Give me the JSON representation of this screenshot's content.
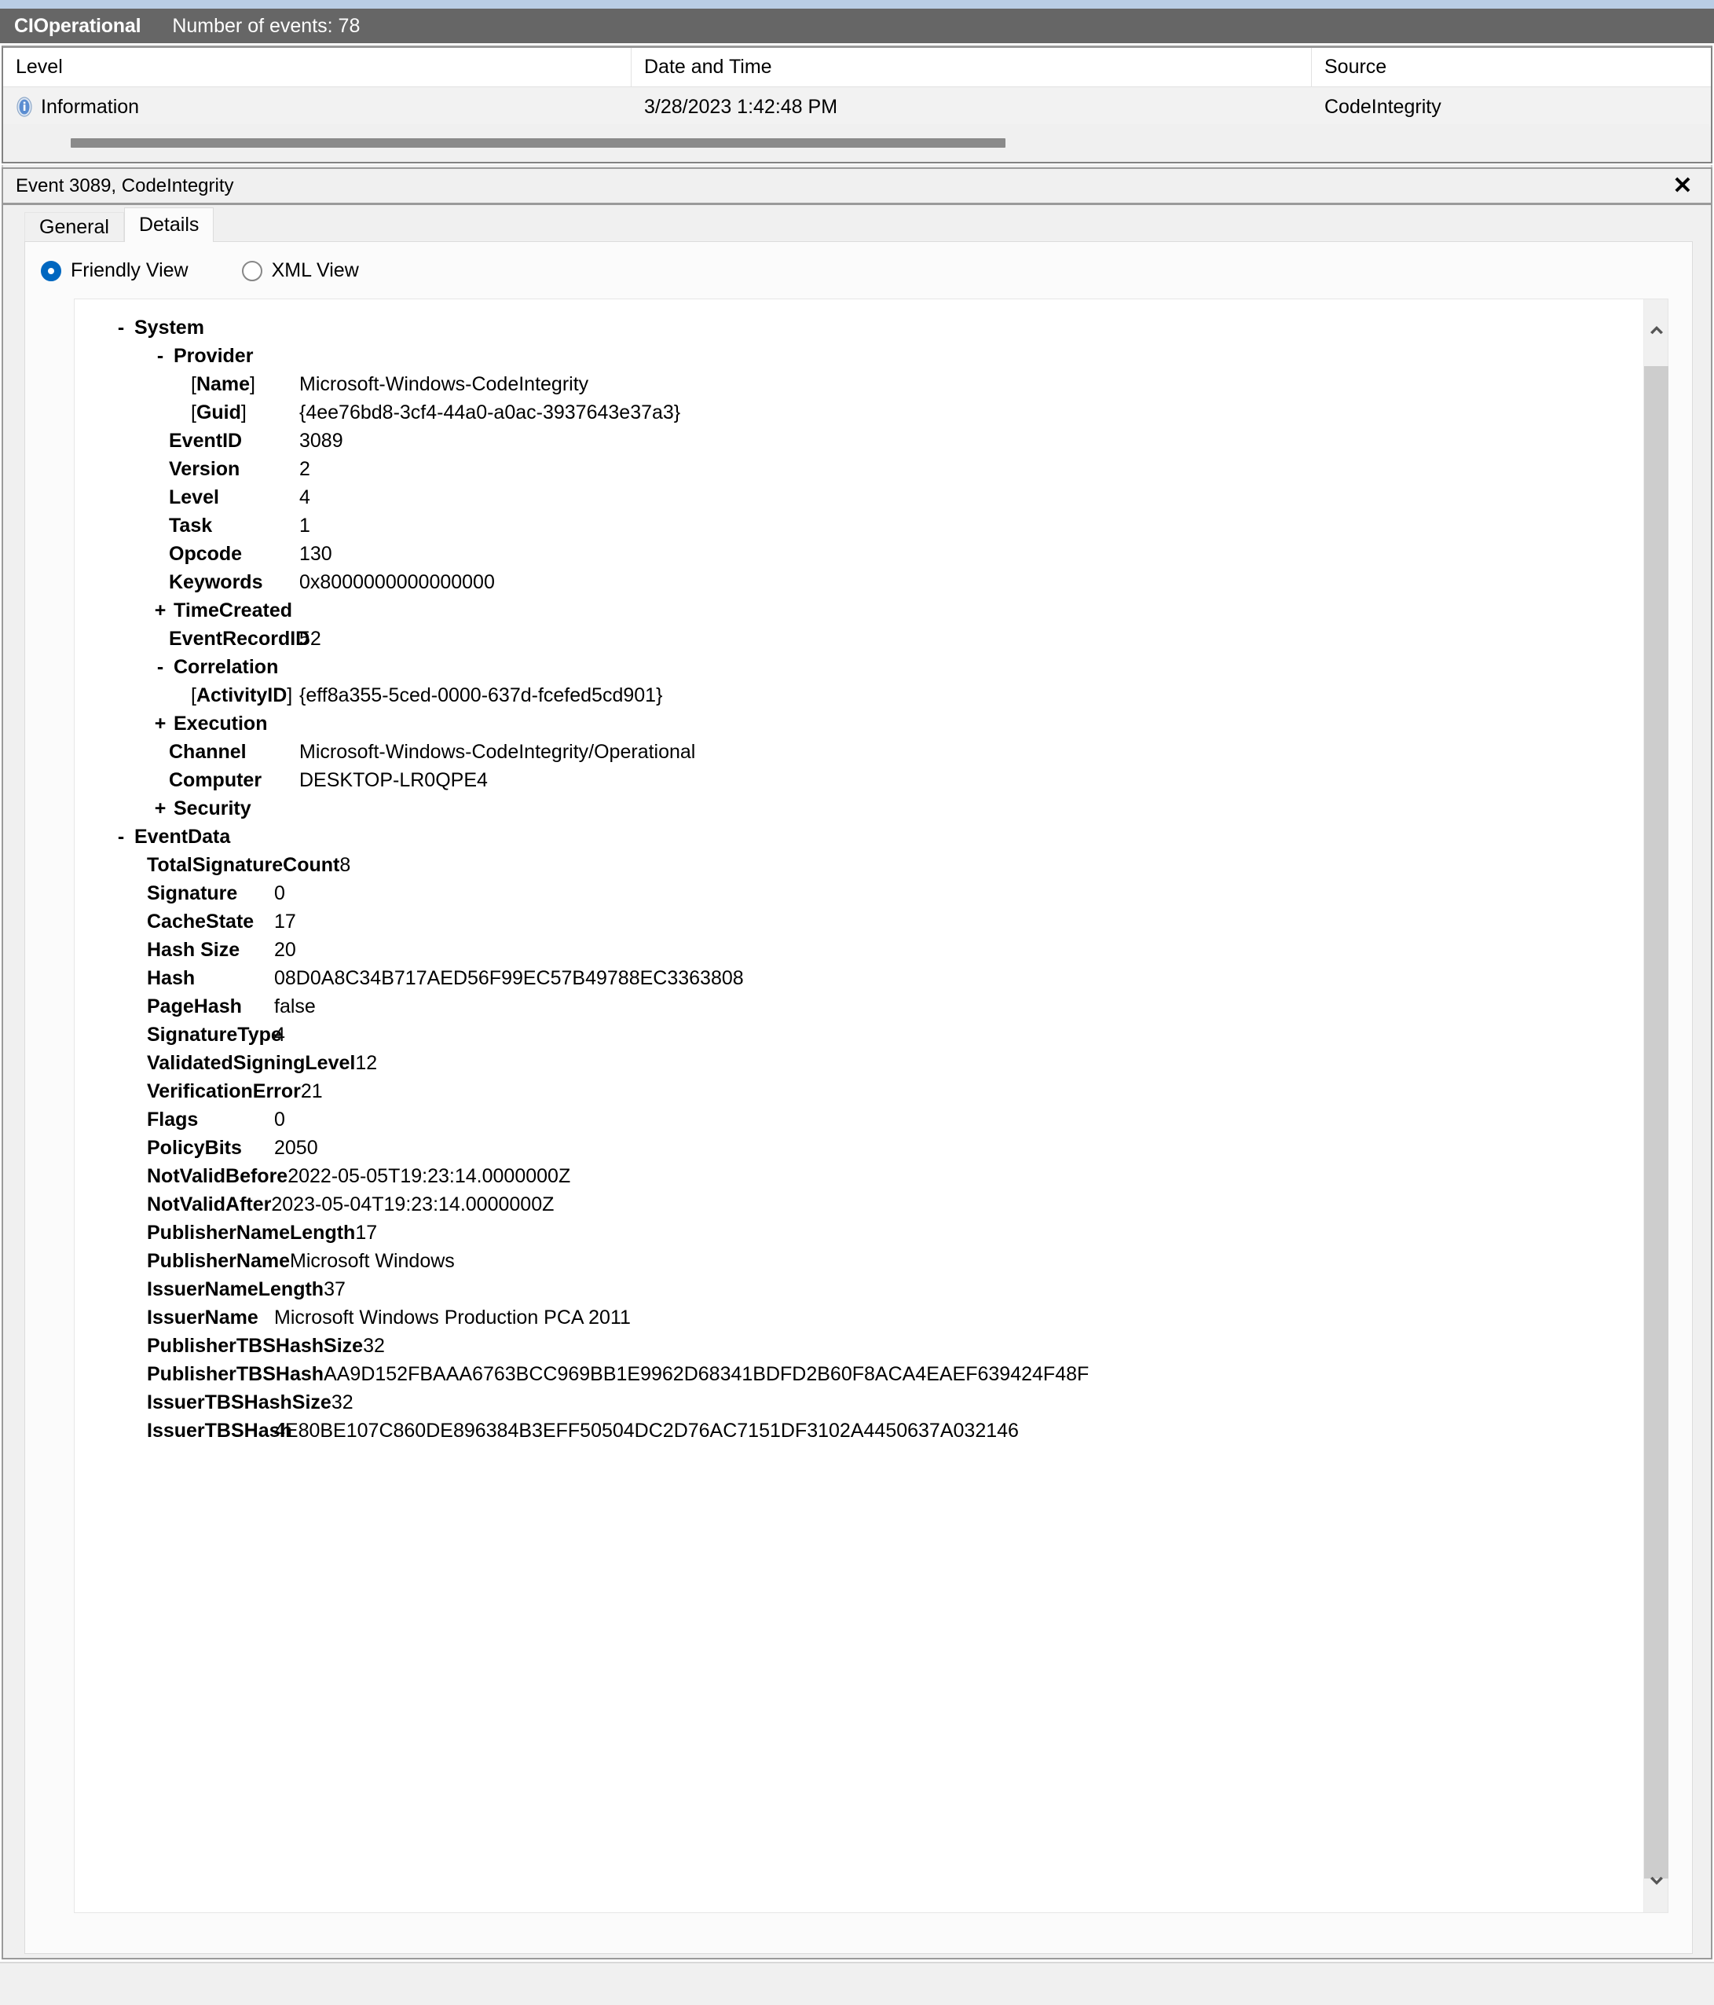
{
  "results_header": {
    "log_name": "CIOperational",
    "event_count_label": "Number of events: 78"
  },
  "event_list": {
    "columns": [
      "Level",
      "Date and Time",
      "Source"
    ],
    "rows": [
      {
        "level_icon": "information-icon",
        "level": "Information",
        "date_time": "3/28/2023 1:42:48 PM",
        "source": "CodeIntegrity"
      }
    ]
  },
  "details_pane": {
    "title": "Event 3089, CodeIntegrity",
    "close_label": "✕",
    "tabs": [
      {
        "label": "General",
        "active": false
      },
      {
        "label": "Details",
        "active": true
      }
    ],
    "view_modes": [
      {
        "label": "Friendly View",
        "selected": true
      },
      {
        "label": "XML View",
        "selected": false
      }
    ],
    "scrollbar": {
      "up_icon": "chevron-up-icon",
      "down_icon": "chevron-down-icon"
    }
  },
  "tree": {
    "system": {
      "toggle": "-",
      "label": "System",
      "provider": {
        "toggle": "-",
        "label": "Provider",
        "attrs": [
          {
            "open": "[",
            "key": "Name",
            "close": "]",
            "value": "Microsoft-Windows-CodeIntegrity"
          },
          {
            "open": "[",
            "key": "Guid",
            "close": "]",
            "value": "{4ee76bd8-3cf4-44a0-a0ac-3937643e37a3}"
          }
        ]
      },
      "fields_a": [
        {
          "key": "EventID",
          "value": "3089"
        },
        {
          "key": "Version",
          "value": "2"
        },
        {
          "key": "Level",
          "value": "4"
        },
        {
          "key": "Task",
          "value": "1"
        },
        {
          "key": "Opcode",
          "value": "130"
        },
        {
          "key": "Keywords",
          "value": "0x8000000000000000"
        }
      ],
      "time_created": {
        "toggle": "+",
        "label": "TimeCreated"
      },
      "event_record_id": {
        "key": "EventRecordID",
        "value": "52"
      },
      "correlation": {
        "toggle": "-",
        "label": "Correlation",
        "attrs": [
          {
            "open": "[",
            "key": "ActivityID",
            "close": "]",
            "value": "{eff8a355-5ced-0000-637d-fcefed5cd901}"
          }
        ]
      },
      "execution": {
        "toggle": "+",
        "label": "Execution"
      },
      "fields_b": [
        {
          "key": "Channel",
          "value": "Microsoft-Windows-CodeIntegrity/Operational"
        },
        {
          "key": "Computer",
          "value": "DESKTOP-LR0QPE4"
        }
      ],
      "security": {
        "toggle": "+",
        "label": "Security"
      }
    },
    "event_data": {
      "toggle": "-",
      "label": "EventData",
      "fields": [
        {
          "key": "TotalSignatureCount",
          "value": "8",
          "wide": true
        },
        {
          "key": "Signature",
          "value": "0",
          "wide": false
        },
        {
          "key": "CacheState",
          "value": "17",
          "wide": false
        },
        {
          "key": "Hash Size",
          "value": "20",
          "wide": false
        },
        {
          "key": "Hash",
          "value": "08D0A8C34B717AED56F99EC57B49788EC3363808",
          "wide": false
        },
        {
          "key": "PageHash",
          "value": "false",
          "wide": false
        },
        {
          "key": "SignatureType",
          "value": "4",
          "wide": false
        },
        {
          "key": "ValidatedSigningLevel",
          "value": "12",
          "wide": true
        },
        {
          "key": "VerificationError",
          "value": "21",
          "wide": true
        },
        {
          "key": "Flags",
          "value": "0",
          "wide": false
        },
        {
          "key": "PolicyBits",
          "value": "2050",
          "wide": false
        },
        {
          "key": "NotValidBefore",
          "value": "2022-05-05T19:23:14.0000000Z",
          "wide": true
        },
        {
          "key": "NotValidAfter",
          "value": "2023-05-04T19:23:14.0000000Z",
          "wide": true
        },
        {
          "key": "PublisherNameLength",
          "value": "17",
          "wide": true
        },
        {
          "key": "PublisherName",
          "value": "Microsoft Windows",
          "wide": true
        },
        {
          "key": "IssuerNameLength",
          "value": "37",
          "wide": true
        },
        {
          "key": "IssuerName",
          "value": "Microsoft Windows Production PCA 2011",
          "wide": false
        },
        {
          "key": "PublisherTBSHashSize",
          "value": "32",
          "wide": true
        },
        {
          "key": "PublisherTBSHash",
          "value": "AA9D152FBAAA6763BCC969BB1E9962D68341BDFD2B60F8ACA4EAEF639424F48F",
          "wide": true
        },
        {
          "key": "IssuerTBSHashSize",
          "value": "32",
          "wide": true
        },
        {
          "key": "IssuerTBSHash",
          "value": "4E80BE107C860DE896384B3EFF50504DC2D76AC7151DF3102A4450637A032146",
          "wide": false
        }
      ]
    }
  },
  "colors": {
    "header_bar": "#666666",
    "top_accent": "#b9cde5",
    "accent_blue": "#0067c0",
    "pane_bg": "#f0f0f0",
    "content_bg": "#ffffff",
    "scroll_thumb": "#cdcdcd"
  }
}
